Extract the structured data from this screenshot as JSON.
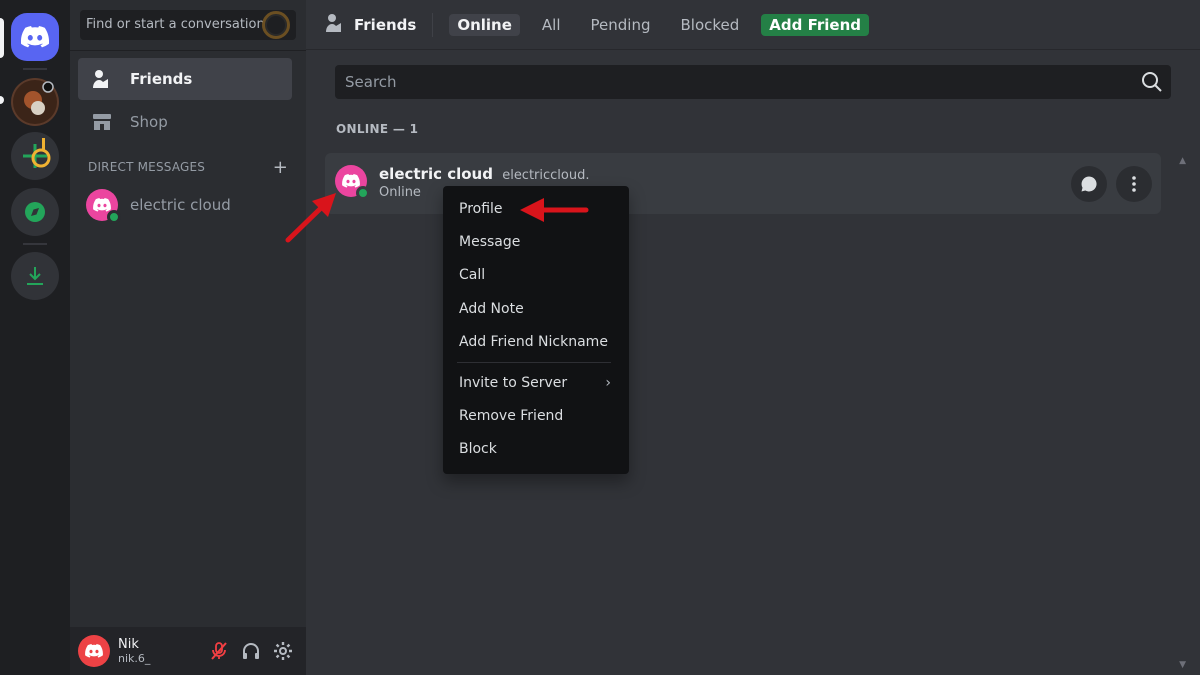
{
  "search_bar": {
    "placeholder": "Find or start a conversation"
  },
  "sidebar": {
    "items": [
      {
        "label": "Friends",
        "icon": "friends-icon",
        "active": true
      },
      {
        "label": "Shop",
        "icon": "shop-icon",
        "active": false
      }
    ],
    "dm_header": "DIRECT MESSAGES",
    "dm_add_icon": "plus-icon",
    "dms": [
      {
        "name": "electric cloud",
        "status": "online"
      }
    ]
  },
  "user_panel": {
    "name": "Nik",
    "tag": "nik.6_",
    "controls": [
      "mic-muted-icon",
      "headphones-icon",
      "gear-icon"
    ]
  },
  "topbar": {
    "title": "Friends",
    "tabs": [
      {
        "label": "Online",
        "active": true
      },
      {
        "label": "All",
        "active": false
      },
      {
        "label": "Pending",
        "active": false
      },
      {
        "label": "Blocked",
        "active": false
      },
      {
        "label": "Add Friend",
        "style": "add"
      }
    ]
  },
  "friends_search": {
    "placeholder": "Search"
  },
  "online_header": "ONLINE — 1",
  "friend": {
    "display_name": "electric cloud",
    "username": "electriccloud.",
    "status": "Online"
  },
  "context_menu": {
    "items": [
      "Profile",
      "Message",
      "Call",
      "Add Note",
      "Add Friend Nickname"
    ],
    "items2": [
      "Invite to Server",
      "Remove Friend",
      "Block"
    ]
  },
  "colors": {
    "brand": "#5865f2",
    "online": "#23a55a",
    "add_friend": "#248046",
    "avatar": "#eb459f",
    "annotation": "#d9141b"
  }
}
